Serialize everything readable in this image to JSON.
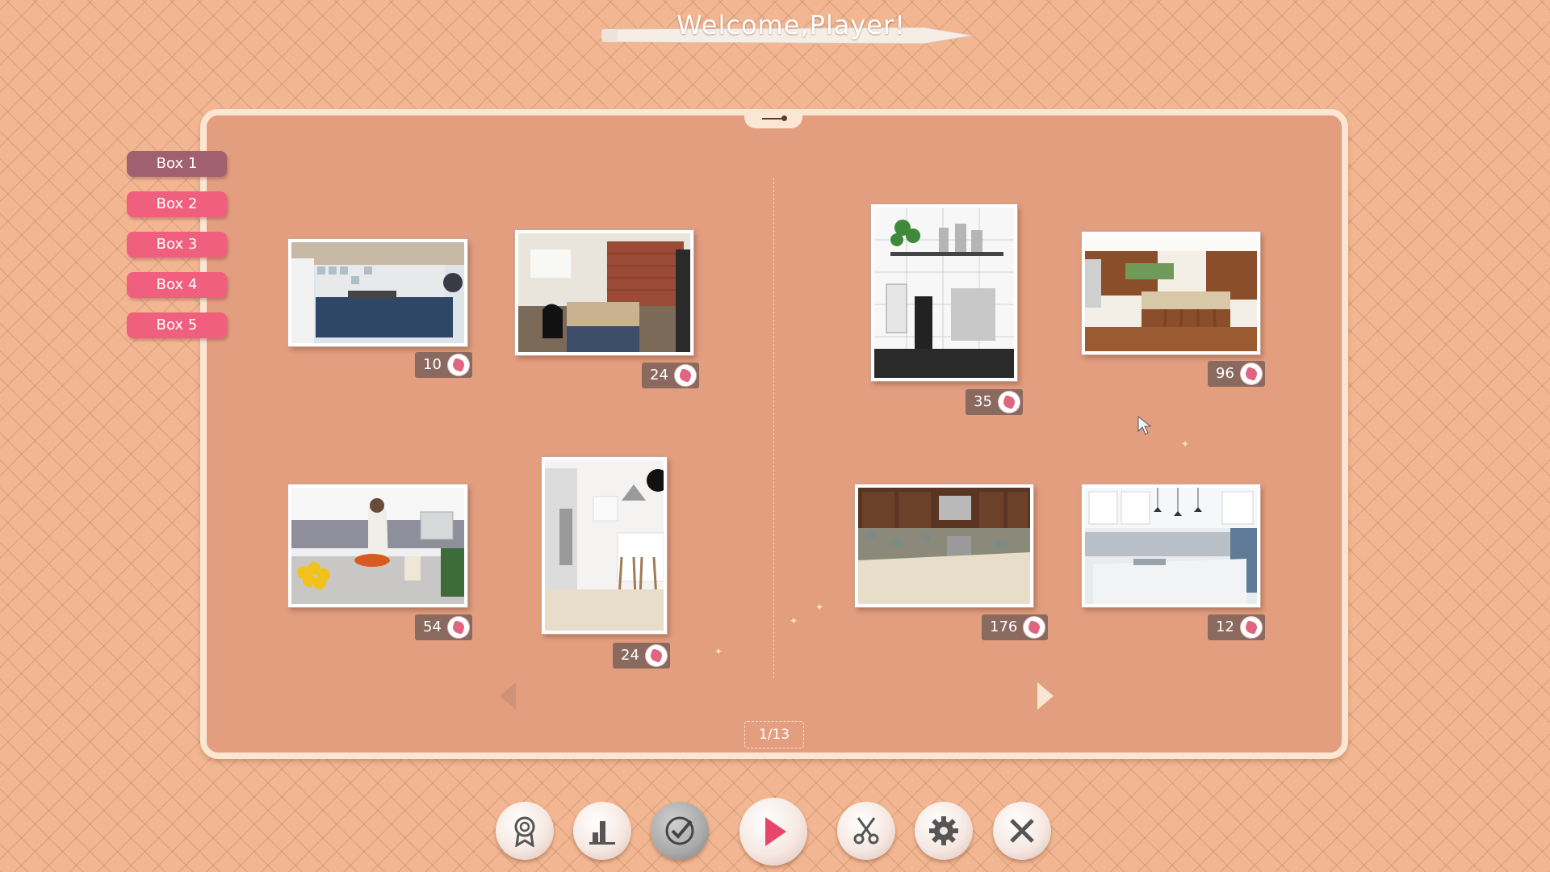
{
  "header": {
    "title": "Welcome,Player!"
  },
  "tabs": [
    {
      "label": "Box 1",
      "active": true
    },
    {
      "label": "Box 2",
      "active": false
    },
    {
      "label": "Box 3",
      "active": false
    },
    {
      "label": "Box 4",
      "active": false
    },
    {
      "label": "Box 5",
      "active": false
    }
  ],
  "puzzles": [
    {
      "pieces": "10",
      "scene": "blue kitchen cabinets with tiled backsplash"
    },
    {
      "pieces": "24",
      "scene": "kitchen with brick wall and island"
    },
    {
      "pieces": "54",
      "scene": "woman cooking at counter with lemons"
    },
    {
      "pieces": "24",
      "scene": "white kitchen with bar stools"
    },
    {
      "pieces": "35",
      "scene": "coffee machines on white tiled shelf"
    },
    {
      "pieces": "96",
      "scene": "wooden kitchen with island and stools"
    },
    {
      "pieces": "176",
      "scene": "dark wood cabinets and stone backsplash"
    },
    {
      "pieces": "12",
      "scene": "white kitchen island with pendant lights"
    }
  ],
  "pager": {
    "label": "1/13"
  },
  "toolbar": [
    {
      "name": "achievements-button",
      "icon": "award-icon"
    },
    {
      "name": "statistics-button",
      "icon": "bar-chart-icon"
    },
    {
      "name": "completed-button",
      "icon": "checkmark-icon"
    },
    {
      "name": "play-button",
      "icon": "play-icon"
    },
    {
      "name": "cut-button",
      "icon": "scissors-icon"
    },
    {
      "name": "settings-button",
      "icon": "gear-icon"
    },
    {
      "name": "close-button",
      "icon": "close-icon"
    }
  ],
  "colors": {
    "background": "#f2b792",
    "board": "#e29e7f",
    "tab": "#f0607e",
    "tab_active": "#a06070",
    "count_badge": "#8a6a5e"
  }
}
